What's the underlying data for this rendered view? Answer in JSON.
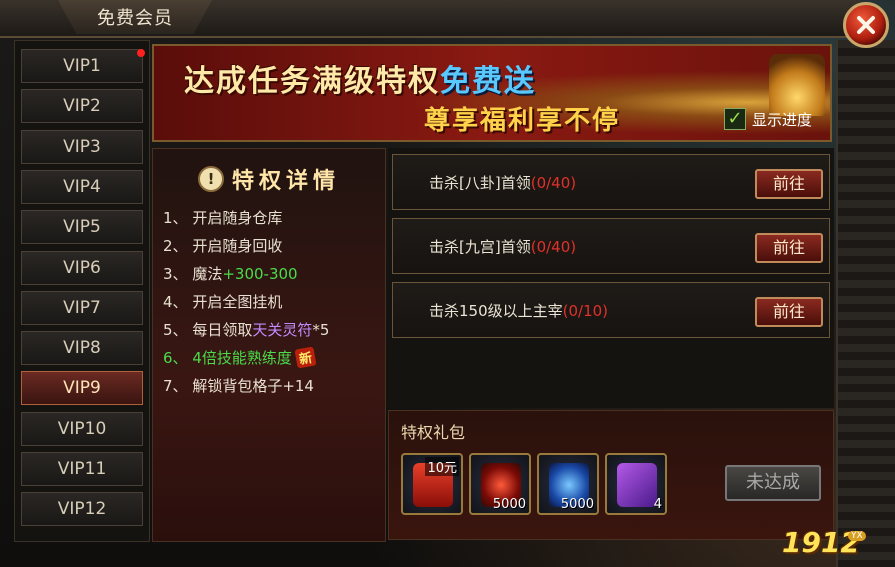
{
  "window": {
    "title": "免费会员"
  },
  "vip_tabs": [
    "VIP1",
    "VIP2",
    "VIP3",
    "VIP4",
    "VIP5",
    "VIP6",
    "VIP7",
    "VIP8",
    "VIP9",
    "VIP10",
    "VIP11",
    "VIP12"
  ],
  "active_vip": "VIP9",
  "banner": {
    "line1_a": "达成任务满级特权",
    "line1_b": "免费送",
    "line2": "尊享福利享不停",
    "show_progress_label": "显示进度",
    "show_progress_checked": true
  },
  "details": {
    "title": "特权详情",
    "perks": [
      {
        "num": "1、",
        "text": "开启随身仓库"
      },
      {
        "num": "2、",
        "text": "开启随身回收"
      },
      {
        "num": "3、",
        "text": "魔法",
        "green": "+300-300"
      },
      {
        "num": "4、",
        "text": "开启全图挂机"
      },
      {
        "num": "5、",
        "text": "每日领取",
        "purple": "天关灵符",
        "suffix": "*5"
      },
      {
        "num": "6、",
        "text": "4倍技能熟练度",
        "badge": "新"
      },
      {
        "num": "7、",
        "text": "解锁背包格子+14"
      }
    ]
  },
  "tasks": [
    {
      "label": "击杀[八卦]首领",
      "progress": "(0/40)",
      "button": "前往"
    },
    {
      "label": "击杀[九宫]首领",
      "progress": "(0/40)",
      "button": "前往"
    },
    {
      "label": "击杀150级以上主宰",
      "progress": "(0/10)",
      "button": "前往"
    }
  ],
  "gift": {
    "title": "特权礼包",
    "items": [
      {
        "icon": "red-envelope-icon",
        "tag": "10元",
        "qty": ""
      },
      {
        "icon": "dragon-orb-icon",
        "tag": "",
        "qty": "5000"
      },
      {
        "icon": "soul-orb-icon",
        "tag": "",
        "qty": "5000"
      },
      {
        "icon": "bag-scroll-icon",
        "tag": "",
        "qty": "4"
      }
    ],
    "claim_button": "未达成"
  },
  "watermark": {
    "text": "1912",
    "sub": "YX"
  }
}
